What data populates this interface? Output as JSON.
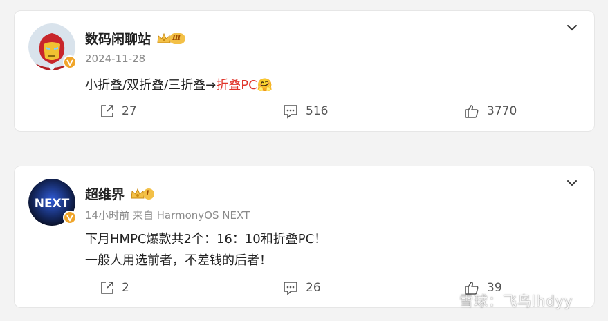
{
  "colors": {
    "highlight": "#e0352b",
    "level_badge": "#f3c047",
    "verified": "#f0a52a"
  },
  "posts": [
    {
      "author": "数码闲聊站",
      "level": "Ⅲ",
      "meta": "2024-11-28",
      "content_lines": [
        {
          "before": "小折叠/双折叠/三折叠→",
          "highlight": "折叠PC",
          "emoji": "🤗"
        }
      ],
      "actions": {
        "share": "27",
        "comment": "516",
        "like": "3770"
      },
      "icons": {
        "avatar": "iron-man-avatar",
        "more": "chevron-down-icon"
      }
    },
    {
      "author": "超维界",
      "level": "Ⅰ",
      "meta": "14小时前 来自 HarmonyOS NEXT",
      "avatar_text": "NEXT",
      "content_lines": [
        "下月HMPC爆款共2个：16：10和折叠PC！",
        "一般人用选前者，不差钱的后者！"
      ],
      "actions": {
        "share": "2",
        "comment": "26",
        "like": "39"
      },
      "icons": {
        "avatar": "harmonyos-next-avatar",
        "more": "chevron-down-icon"
      }
    }
  ],
  "watermark": {
    "text": "雪球：飞鸟lhdyy"
  }
}
